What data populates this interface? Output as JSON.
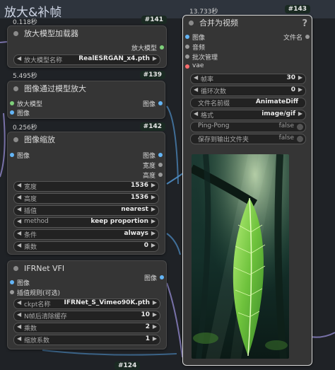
{
  "group": {
    "title": "放大&补帧"
  },
  "nodes": {
    "load_model": {
      "time": "0.118秒",
      "badge": "#141",
      "title": "放大模型加载器",
      "output_label": "放大模型",
      "widget": {
        "label": "放大模型名称",
        "value": "RealESRGAN_x4.pth"
      }
    },
    "upscale_with_model": {
      "time": "5.495秒",
      "badge": "#139",
      "title": "图像通过模型放大",
      "inputs": [
        "放大模型",
        "图像"
      ],
      "output_label": "图像"
    },
    "image_scale": {
      "time": "0.256秒",
      "badge": "#142",
      "title": "图像缩放",
      "input": "图像",
      "outputs": [
        "图像",
        "宽度",
        "高度"
      ],
      "widgets": [
        {
          "label": "宽度",
          "value": "1536"
        },
        {
          "label": "高度",
          "value": "1536"
        },
        {
          "label": "插值",
          "value": "nearest"
        },
        {
          "label": "method",
          "value": "keep proportion"
        },
        {
          "label": "条件",
          "value": "always"
        },
        {
          "label": "乘数",
          "value": "0"
        }
      ]
    },
    "rife": {
      "badge": "#124",
      "title": "IFRNet VFI",
      "inputs": [
        "图像",
        "插值规则(可选)"
      ],
      "output_label": "图像",
      "widgets": [
        {
          "label": "ckpt名称",
          "value": "IFRNet_S_Vimeo90K.pth"
        },
        {
          "label": "N帧后清除缓存",
          "value": "10"
        },
        {
          "label": "乘数",
          "value": "2"
        },
        {
          "label": "缩放系数",
          "value": "1"
        }
      ]
    },
    "combine": {
      "time": "13.733秒",
      "badge": "#143",
      "title": "合并为视频",
      "help": "?",
      "inputs": [
        "图像",
        "音频",
        "批次管理",
        "vae"
      ],
      "output_label": "文件名",
      "widgets": [
        {
          "label": "帧率",
          "value": "30"
        },
        {
          "label": "循环次数",
          "value": "0"
        },
        {
          "label": "文件名前缀",
          "value": "AnimateDiff"
        },
        {
          "label": "格式",
          "value": "image/gif"
        }
      ],
      "toggles": [
        {
          "label": "Ping-Pong",
          "value": "false"
        },
        {
          "label": "保存到输出文件夹",
          "value": "false"
        }
      ]
    }
  },
  "colors": {
    "image_port": "#64b5f6",
    "model_port": "#7ed07a",
    "vae_port": "#ff6e6e",
    "gray_port": "#9a9a9a",
    "wire_purple": "#8e86c9",
    "wire_blue": "#4f8fc8"
  },
  "icons": {
    "arrow_left": "◀",
    "arrow_right": "▶"
  }
}
